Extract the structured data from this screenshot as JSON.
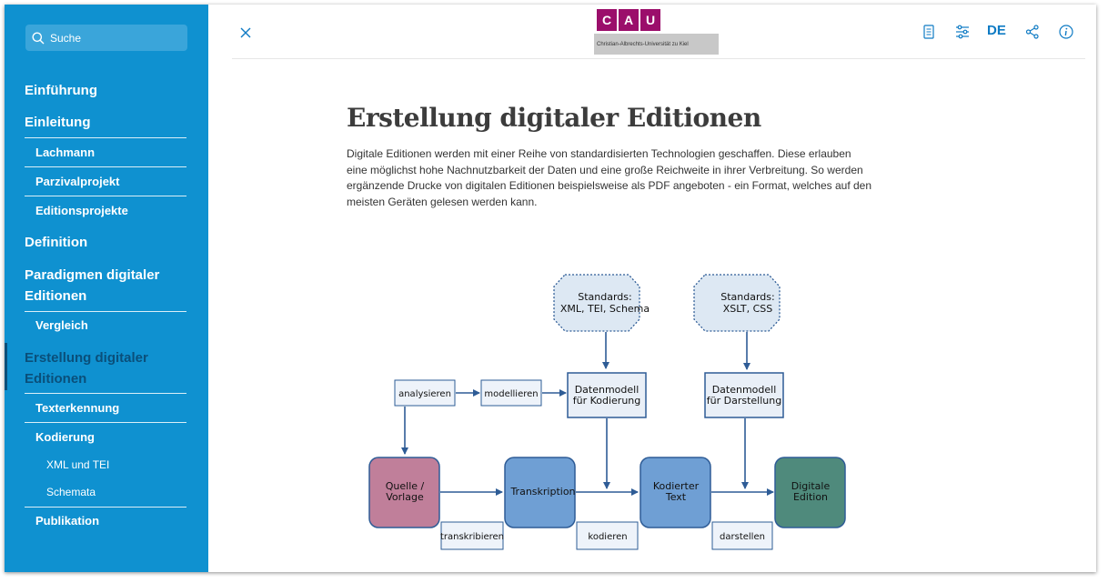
{
  "sidebar": {
    "search_label": "Suche",
    "items": [
      {
        "label": "Einführung"
      },
      {
        "label": "Einleitung"
      },
      {
        "label": "Lachmann"
      },
      {
        "label": "Parzivalprojekt"
      },
      {
        "label": "Editionsprojekte"
      },
      {
        "label": "Definition"
      },
      {
        "label": "Paradigmen digitaler"
      },
      {
        "label": "Editionen"
      },
      {
        "label": "Vergleich"
      },
      {
        "label": "Erstellung digitaler"
      },
      {
        "label": "Editionen"
      },
      {
        "label": "Texterkennung"
      },
      {
        "label": "Kodierung"
      },
      {
        "label": "XML und TEI"
      },
      {
        "label": "Schemata"
      },
      {
        "label": "Publikation"
      }
    ]
  },
  "header": {
    "logo_letters": [
      "C",
      "A",
      "U"
    ],
    "logo_subtitle": "Christian-Albrechts-Universität zu Kiel",
    "language": "DE",
    "icons": [
      "close-icon",
      "document-icon",
      "sliders-icon",
      "share-icon",
      "info-icon"
    ]
  },
  "main": {
    "title": "Erstellung digitaler Editionen",
    "paragraph": "Digitale Editionen werden mit einer Reihe von standardisierten Technologien geschaffen. Diese erlauben eine möglichst hohe Nachnutzbarkeit der Daten und eine große Reichweite in ihrer Verbreitung. So werden ergänzende Drucke von digitalen Editionen beispielsweise als PDF angeboten - ein Format, welches auf den meisten Geräten gelesen werden kann."
  },
  "diagram": {
    "standards_1": [
      "Standards:",
      "XML, TEI, Schema"
    ],
    "standards_2": [
      "Standards:",
      "XSLT, CSS"
    ],
    "datenmodell_1": [
      "Datenmodell",
      "für Kodierung"
    ],
    "datenmodell_2": [
      "Datenmodell",
      "für Darstellung"
    ],
    "analysieren": "analysieren",
    "modellieren": "modellieren",
    "quelle": [
      "Quelle /",
      "Vorlage"
    ],
    "transkription": "Transkription",
    "kodierter_text": [
      "Kodierter",
      "Text"
    ],
    "digitale_edition": [
      "Digitale",
      "Edition"
    ],
    "transkribieren": "transkribieren",
    "kodieren": "kodieren",
    "darstellen": "darstellen"
  },
  "colors": {
    "sidebar_bg": "#0f91d0",
    "accent": "#0f7bc4",
    "logo": "#9b0e6b",
    "quelle_fill": "#c07f9a",
    "process_fill": "#6f9fd4",
    "edition_fill": "#4f8a7c"
  }
}
